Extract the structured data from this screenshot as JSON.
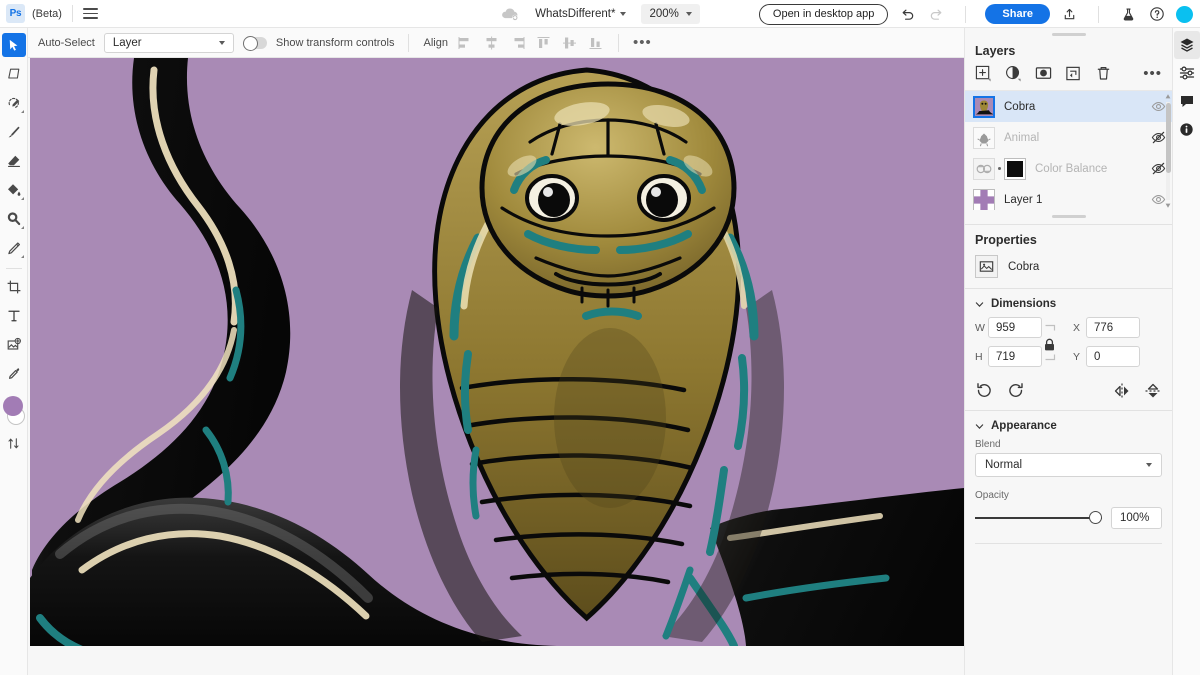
{
  "topbar": {
    "logo_text": "Ps",
    "beta_label": "(Beta)",
    "doc_name": "WhatsDifferent*",
    "zoom_level": "200%",
    "open_desktop_label": "Open in desktop app",
    "share_label": "Share"
  },
  "options_bar": {
    "auto_select_label": "Auto-Select",
    "auto_select_value": "Layer",
    "transform_controls_label": "Show transform controls",
    "transform_controls_on": false,
    "align_label": "Align",
    "overflow_label": "•••"
  },
  "layers_panel": {
    "title": "Layers",
    "overflow_label": "•••",
    "tools": [
      {
        "name": "add-layer-icon"
      },
      {
        "name": "adjustment-layer-icon"
      },
      {
        "name": "layer-mask-icon"
      },
      {
        "name": "group-layer-icon"
      },
      {
        "name": "delete-layer-icon"
      }
    ],
    "items": [
      {
        "name": "Cobra",
        "selected": true,
        "visible": true,
        "kind": "image"
      },
      {
        "name": "Animal",
        "selected": false,
        "visible": false,
        "kind": "image"
      },
      {
        "name": "Color Balance",
        "selected": false,
        "visible": false,
        "kind": "adjustment"
      },
      {
        "name": "Layer 1",
        "selected": false,
        "visible": true,
        "kind": "image"
      }
    ]
  },
  "properties_panel": {
    "title": "Properties",
    "layer_name": "Cobra",
    "dimensions": {
      "section_label": "Dimensions",
      "w_label": "W",
      "w_value": "959",
      "h_label": "H",
      "h_value": "719",
      "x_label": "X",
      "x_value": "776",
      "y_label": "Y",
      "y_value": "0",
      "aspect_locked": true
    },
    "appearance": {
      "section_label": "Appearance",
      "blend_label": "Blend",
      "blend_value": "Normal",
      "opacity_label": "Opacity",
      "opacity_value": "100%",
      "opacity_percent": 100
    }
  },
  "left_toolbar": {
    "tools": [
      {
        "name": "move-tool",
        "active": true
      },
      {
        "name": "transform-tool",
        "active": false
      },
      {
        "name": "quick-select-tool",
        "active": false
      },
      {
        "name": "brush-tool",
        "active": false
      },
      {
        "name": "eraser-tool",
        "active": false
      },
      {
        "name": "paint-bucket-tool",
        "active": false
      },
      {
        "name": "dodge-tool",
        "active": false
      },
      {
        "name": "clone-stamp-tool",
        "active": false
      },
      {
        "name": "crop-tool",
        "active": false
      },
      {
        "name": "type-tool",
        "active": false
      },
      {
        "name": "place-image-tool",
        "active": false
      },
      {
        "name": "eyedropper-tool",
        "active": false
      }
    ],
    "foreground_color": "#a27cb5",
    "background_color": "#ffffff"
  },
  "right_rail": {
    "items": [
      {
        "name": "layers-rail-icon",
        "active": true
      },
      {
        "name": "properties-rail-icon",
        "active": false
      },
      {
        "name": "comments-rail-icon",
        "active": false
      },
      {
        "name": "info-rail-icon",
        "active": false
      }
    ]
  },
  "canvas": {
    "background_color": "#a98ab5",
    "artwork_description": "Illustration of a golden-hooded king cobra with black body, teal accents and cream highlights",
    "colors": {
      "background": "#a98ab5",
      "hood_gold": "#a08a3c",
      "hood_gold_light": "#d4c37a",
      "teal_accent": "#1f7f80",
      "cream_highlight": "#f2e4c0",
      "body_black": "#121212",
      "outline": "#0a0a0a"
    }
  }
}
